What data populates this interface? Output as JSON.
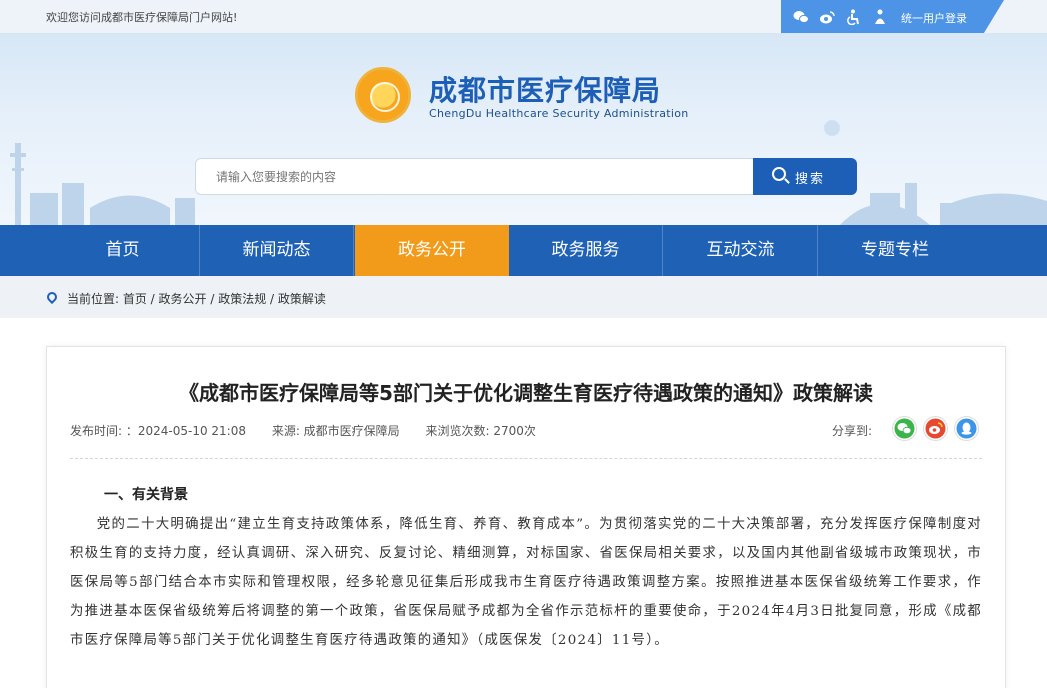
{
  "topbar": {
    "welcome": "欢迎您访问成都市医疗保障局门户网站!",
    "icons": [
      "wechat-icon",
      "weibo-icon",
      "accessibility-icon",
      "elder-care-icon"
    ],
    "login": "统一用户登录"
  },
  "header": {
    "title": "成都市医疗保障局",
    "subtitle": "ChengDu Healthcare Security Administration"
  },
  "search": {
    "placeholder": "请输入您要搜索的内容",
    "button": "搜索"
  },
  "nav": {
    "items": [
      {
        "label": "首页"
      },
      {
        "label": "新闻动态"
      },
      {
        "label": "政务公开"
      },
      {
        "label": "政务服务"
      },
      {
        "label": "互动交流"
      },
      {
        "label": "专题专栏"
      }
    ],
    "active_index": 2
  },
  "breadcrumb": {
    "text": "当前位置:  首页 / 政务公开 / 政策法规 / 政策解读"
  },
  "article": {
    "title": "《成都市医疗保障局等5部门关于优化调整生育医疗待遇政策的通知》政策解读",
    "publish_time": "发布时间: ：2024-05-10 21:08",
    "source": "来源:  成都市医疗保障局",
    "views": "来浏览次数:  2700次",
    "share_label": "分享到:",
    "section_heading": "一、有关背景",
    "paragraph": "党的二十大明确提出“建立生育支持政策体系，降低生育、养育、教育成本”。为贯彻落实党的二十大决策部署，充分发挥医疗保障制度对积极生育的支持力度，经认真调研、深入研究、反复讨论、精细测算，对标国家、省医保局相关要求，以及国内其他副省级城市政策现状，市医保局等5部门结合本市实际和管理权限，经多轮意见征集后形成我市生育医疗待遇政策调整方案。按照推进基本医保省级统筹工作要求，作为推进基本医保省级统筹后将调整的第一个政策，省医保局赋予成都为全省作示范标杆的重要使命，于2024年4月3日批复同意，形成《成都市医疗保障局等5部门关于优化调整生育医疗待遇政策的通知》（成医保发〔2024〕11号）。"
  },
  "colors": {
    "primary": "#1f61b5",
    "active_nav": "#f29a1a",
    "topbar_accent": "#4d94e6",
    "wechat": "#3ab54a",
    "weibo": "#e6492f",
    "qq": "#3d95e8"
  }
}
